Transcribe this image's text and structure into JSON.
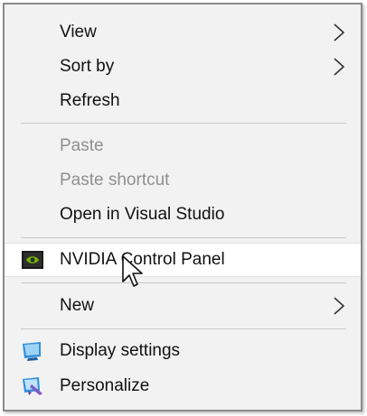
{
  "context_menu": {
    "items": [
      {
        "label": "View",
        "has_submenu": true,
        "enabled": true
      },
      {
        "label": "Sort by",
        "has_submenu": true,
        "enabled": true
      },
      {
        "label": "Refresh",
        "has_submenu": false,
        "enabled": true
      },
      {
        "label": "Paste",
        "has_submenu": false,
        "enabled": false
      },
      {
        "label": "Paste shortcut",
        "has_submenu": false,
        "enabled": false
      },
      {
        "label": "Open in Visual Studio",
        "has_submenu": false,
        "enabled": true
      },
      {
        "label": "NVIDIA Control Panel",
        "has_submenu": false,
        "enabled": true,
        "icon": "nvidia-icon",
        "highlighted": true
      },
      {
        "label": "New",
        "has_submenu": true,
        "enabled": true
      },
      {
        "label": "Display settings",
        "has_submenu": false,
        "enabled": true,
        "icon": "display-settings-icon"
      },
      {
        "label": "Personalize",
        "has_submenu": false,
        "enabled": true,
        "icon": "personalize-icon"
      }
    ]
  },
  "colors": {
    "menu_background": "#f2f2f2",
    "highlight_background": "#ffffff",
    "disabled_text": "#8f8f8f",
    "text": "#111111",
    "nvidia_green": "#76b900"
  },
  "cursor": {
    "icon": "mouse-pointer-icon"
  }
}
